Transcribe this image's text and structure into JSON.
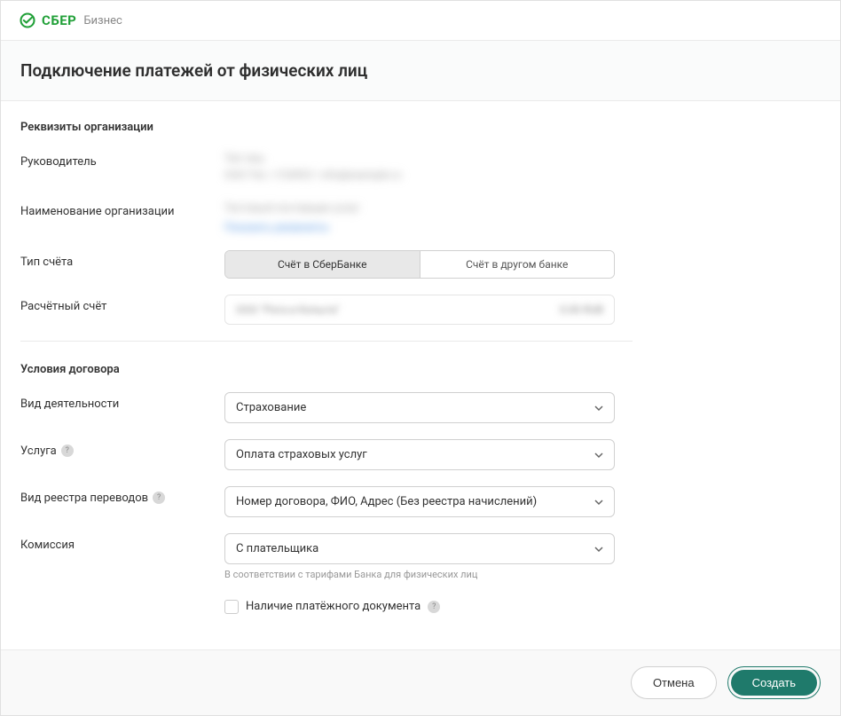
{
  "header": {
    "logo_main": "СБЕР",
    "logo_sub": "Бизнес"
  },
  "page": {
    "title": "Подключение платежей от физических лиц"
  },
  "sections": {
    "org_details": "Реквизиты организации",
    "contract_terms": "Условия договора"
  },
  "fields": {
    "manager_label": "Руководитель",
    "manager_value": "Тип лиц",
    "manager_sub": "ООО   Тел. +7(499)1-   info@example.ru",
    "org_name_label": "Наименование организации",
    "org_name_value": "Тестовый поставщик услуг",
    "org_name_link": "Показать реквизиты",
    "account_type_label": "Тип счёта",
    "account_type_opt1": "Счёт в СберБанке",
    "account_type_opt2": "Счёт в другом банке",
    "account_label": "Расчётный счёт",
    "account_value": "ООО \"Рога и Копыта\"",
    "account_balance": "0.00 RUB",
    "activity_label": "Вид деятельности",
    "activity_value": "Страхование",
    "service_label": "Услуга",
    "service_value": "Оплата страховых услуг",
    "registry_label": "Вид реестра переводов",
    "registry_value": "Номер договора, ФИО, Адрес (Без реестра начислений)",
    "commission_label": "Комиссия",
    "commission_value": "С плательщика",
    "commission_hint": "В соответствии с тарифами Банка для физических лиц",
    "doc_checkbox_label": "Наличие платёжного документа"
  },
  "footer": {
    "cancel": "Отмена",
    "create": "Создать"
  }
}
